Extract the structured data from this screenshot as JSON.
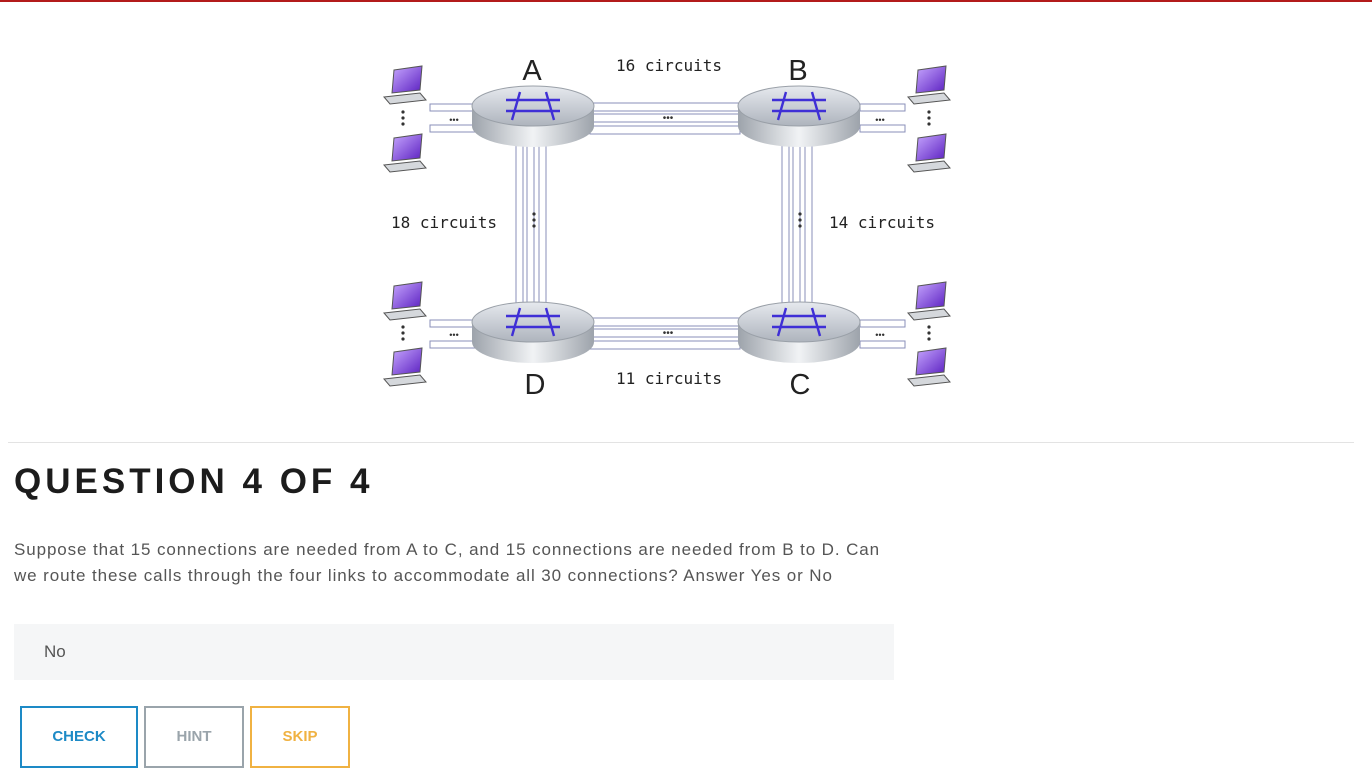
{
  "diagram": {
    "nodes": {
      "a": "A",
      "b": "B",
      "c": "C",
      "d": "D"
    },
    "links": {
      "ab": "16 circuits",
      "bc": "14 circuits",
      "dc": "11 circuits",
      "ad": "18 circuits"
    }
  },
  "question": {
    "title": "QUESTION 4 OF 4",
    "text": "Suppose that 15 connections are needed from A to C, and 15 connections are needed from B to D. Can we route these calls through the four links to accommodate all 30 connections? Answer Yes or No",
    "answer_value": "No"
  },
  "buttons": {
    "check": "CHECK",
    "hint": "HINT",
    "skip": "SKIP"
  },
  "colors": {
    "top_rule": "#b31b1b",
    "check": "#1d8ac6",
    "hint": "#9aa4ab",
    "skip": "#f0b242",
    "switch_fabric": "#3f2fd6",
    "computer_screen": "#7a3fe0"
  }
}
